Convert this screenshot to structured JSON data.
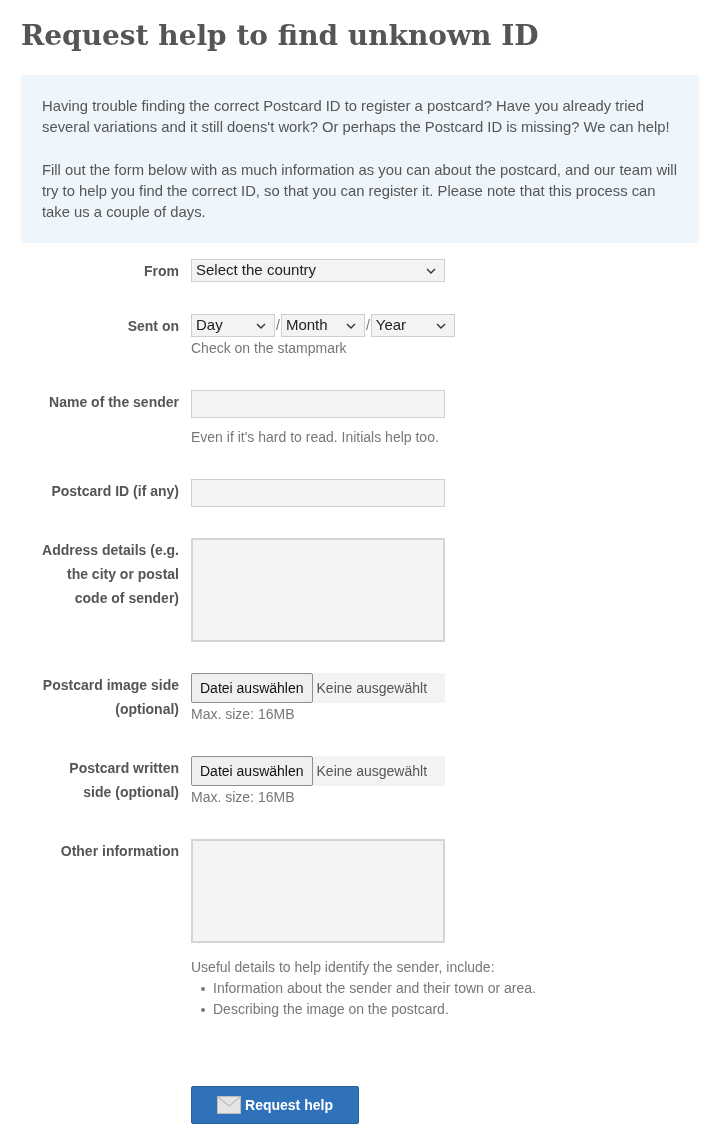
{
  "title": "Request help to find unknown ID",
  "intro": [
    "Having trouble finding the correct Postcard ID to register a postcard? Have you already tried several variations and it still doens't work? Or perhaps the Postcard ID is missing? We can help!",
    "Fill out the form below with as much information as you can about the postcard, and our team will try to help you find the correct ID, so that you can register it. Please note that this process can take us a couple of days."
  ],
  "fields": [
    {
      "kind": "select",
      "label": "From",
      "value": "Select the country"
    },
    {
      "kind": "date",
      "label": "Sent on",
      "parts": [
        "Day",
        "Month",
        "Year"
      ],
      "separators": [
        "/",
        "/"
      ],
      "hint": "Check on the stampmark"
    },
    {
      "kind": "text",
      "label": "Name of the sender",
      "hint": "Even if it's hard to read. Initials help too."
    },
    {
      "kind": "text",
      "label": "Postcard ID (if any)"
    },
    {
      "kind": "textarea",
      "label": "Address details (e.g. the city or postal code of sender)"
    },
    {
      "kind": "file",
      "label": "Postcard image side (optional)",
      "button": "Datei auswählen",
      "status": "Keine ausgewählt",
      "hint": "Max. size: 16MB"
    },
    {
      "kind": "file",
      "label": "Postcard written side (optional)",
      "button": "Datei auswählen",
      "status": "Keine ausgewählt",
      "hint": "Max. size: 16MB"
    },
    {
      "kind": "textarea",
      "label": "Other information",
      "hint": "Useful details to help identify the sender, include:",
      "hint_list": [
        "Information about the sender and their town or area.",
        "Describing the image on the postcard."
      ]
    }
  ],
  "submit": {
    "label": "Request help"
  }
}
